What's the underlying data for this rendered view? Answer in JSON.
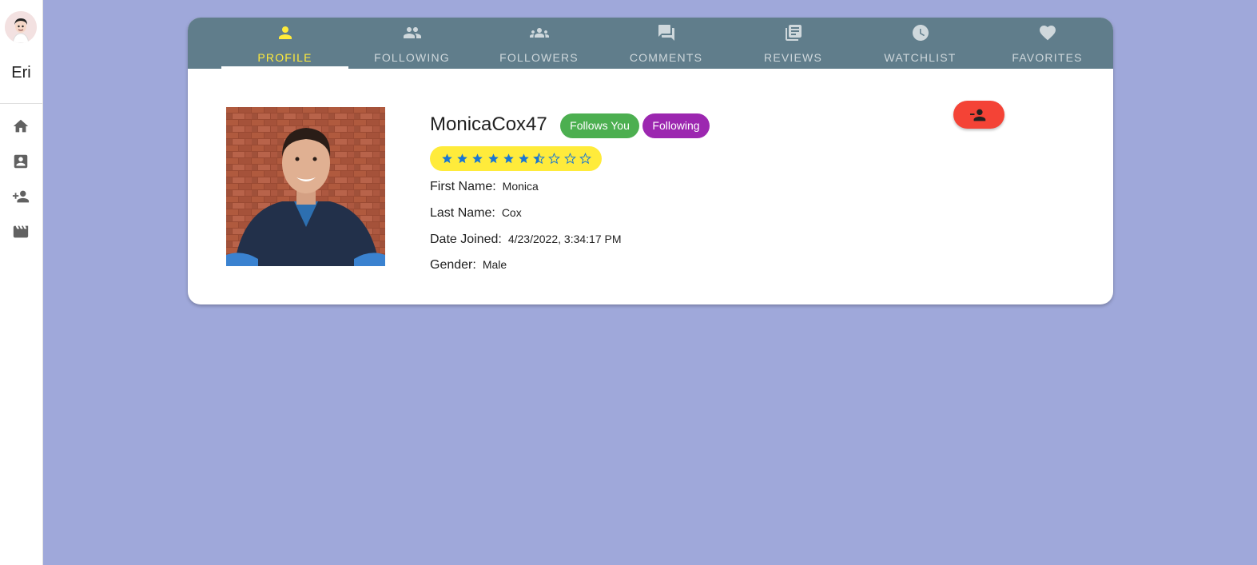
{
  "sidebar": {
    "user_label": "Eri",
    "nav": [
      {
        "icon": "home-icon"
      },
      {
        "icon": "contact-card-icon"
      },
      {
        "icon": "person-add-icon"
      },
      {
        "icon": "movie-clapper-icon"
      }
    ]
  },
  "tabs": [
    {
      "label": "PROFILE",
      "icon": "person-icon",
      "active": true
    },
    {
      "label": "FOLLOWING",
      "icon": "people-icon",
      "active": false
    },
    {
      "label": "FOLLOWERS",
      "icon": "groups-icon",
      "active": false
    },
    {
      "label": "COMMENTS",
      "icon": "forum-icon",
      "active": false
    },
    {
      "label": "REVIEWS",
      "icon": "library-books-icon",
      "active": false
    },
    {
      "label": "WATCHLIST",
      "icon": "clock-icon",
      "active": false
    },
    {
      "label": "FAVORITES",
      "icon": "heart-icon",
      "active": false
    }
  ],
  "profile": {
    "username": "MonicaCox47",
    "chips": {
      "follows_you": "Follows You",
      "following": "Following"
    },
    "rating": {
      "value": 6.5,
      "max": 10
    },
    "fields": {
      "first_name_label": "First Name:",
      "first_name": "Monica",
      "last_name_label": "Last Name:",
      "last_name": "Cox",
      "date_joined_label": "Date Joined:",
      "date_joined": "4/23/2022, 3:34:17 PM",
      "gender_label": "Gender:",
      "gender": "Male"
    },
    "unfollow_icon": "person-remove-icon"
  },
  "colors": {
    "background": "#9fa8da",
    "tab_bar": "#607d8b",
    "active_tab": "#ffeb3b",
    "follows_you_chip": "#4caf50",
    "following_chip": "#9c27b0",
    "unfollow_button": "#f44336",
    "star": "#1976d2"
  }
}
